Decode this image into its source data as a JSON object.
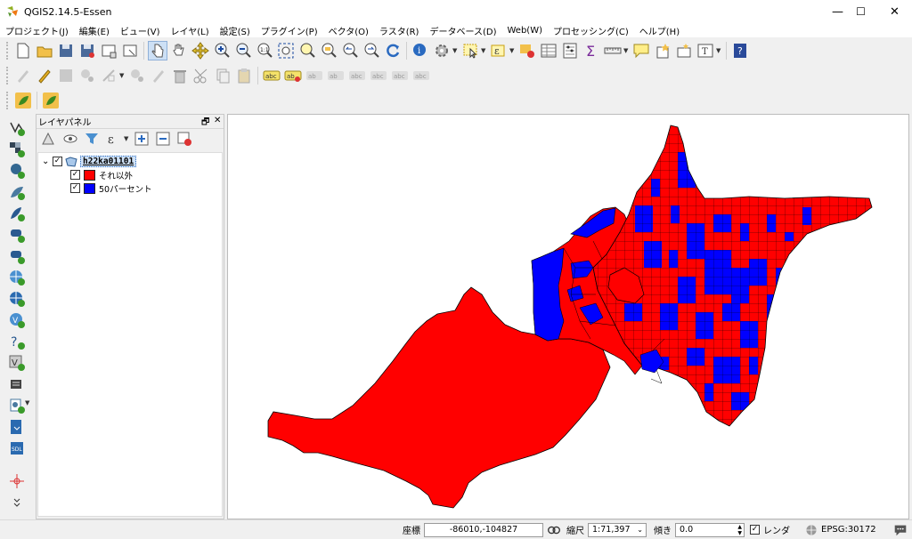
{
  "window": {
    "title": "QGIS2.14.5-Essen",
    "minimize": "—",
    "maximize": "☐",
    "close": "✕"
  },
  "menu": [
    "プロジェクト(J)",
    "編集(E)",
    "ビュー(V)",
    "レイヤ(L)",
    "設定(S)",
    "プラグイン(P)",
    "ベクタ(O)",
    "ラスタ(R)",
    "データベース(D)",
    "Web(W)",
    "プロセッシング(C)",
    "ヘルプ(H)"
  ],
  "layer_panel": {
    "title": "レイヤパネル",
    "float_glyph": "🗗",
    "close_glyph": "✕",
    "layer_name": "h22ka01101",
    "expand_glyph": "⌄",
    "legend": [
      {
        "label": "それ以外",
        "color": "#ff0000"
      },
      {
        "label": "50パーセント",
        "color": "#0000ff"
      }
    ]
  },
  "statusbar": {
    "coord_label": "座標",
    "coord_value": "-86010,-104827",
    "scale_label": "縮尺",
    "scale_value": "1:71,397",
    "rotation_label": "傾き",
    "rotation_value": "0.0",
    "render_label": "レンダ",
    "crs": "EPSG:30172"
  },
  "colors": {
    "other": "#ff0000",
    "fifty_percent": "#0000ff",
    "accent": "#3a74c8"
  }
}
